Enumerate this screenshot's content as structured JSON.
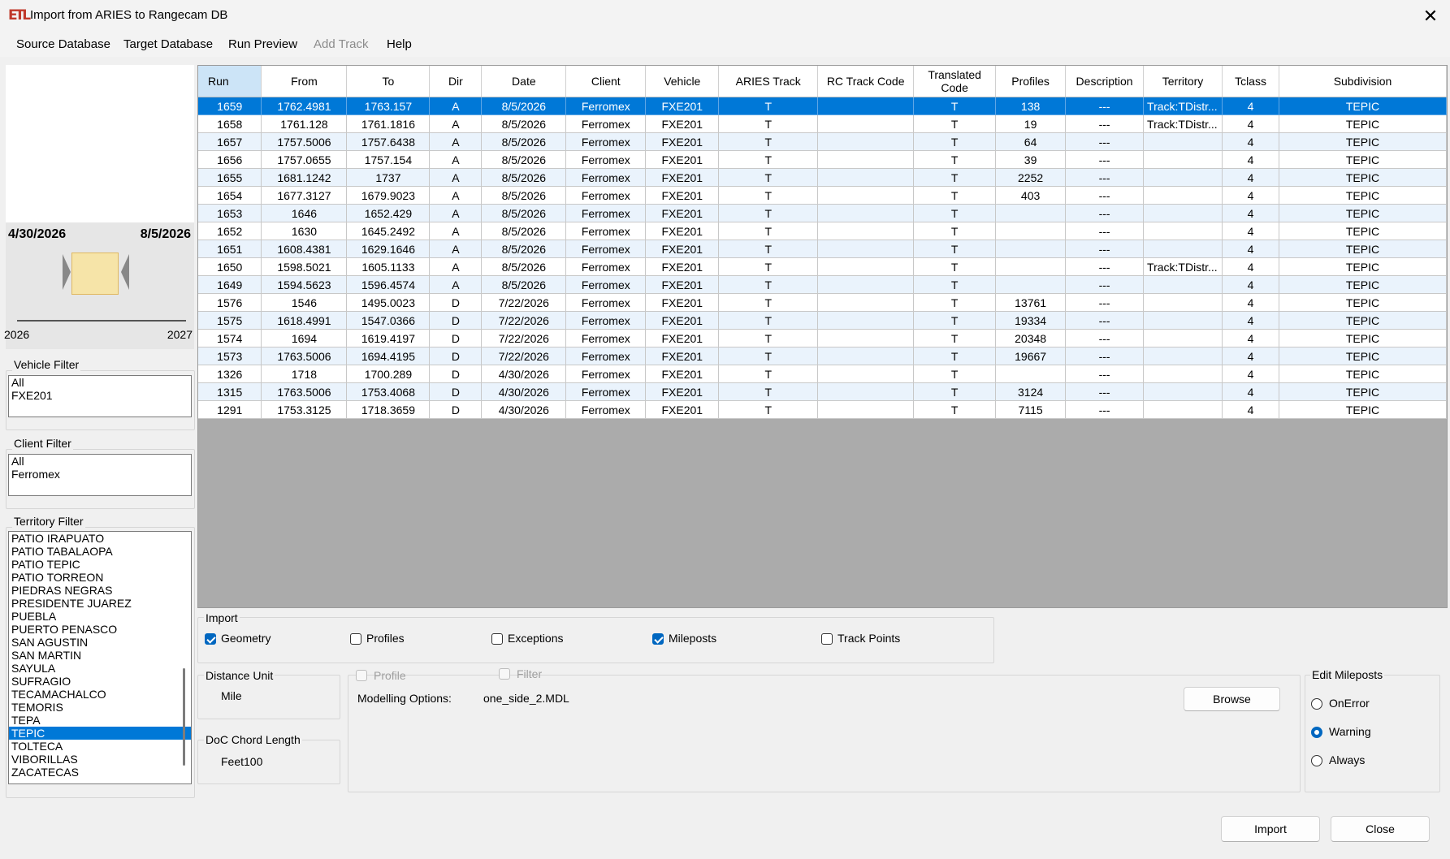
{
  "window": {
    "title": "Import from ARIES to Rangecam DB",
    "app_icon": "ETL",
    "close_symbol": "✕"
  },
  "menu": [
    {
      "label": "Source Database",
      "enabled": true
    },
    {
      "label": "Target Database",
      "enabled": true
    },
    {
      "label": "Run Preview",
      "enabled": true
    },
    {
      "label": "Add Track",
      "enabled": false
    },
    {
      "label": "Help",
      "enabled": true
    }
  ],
  "date_range": {
    "start": "4/30/2026",
    "end": "8/5/2026",
    "axis_start": "2026",
    "axis_end": "2027"
  },
  "vehicle_filter": {
    "label": "Vehicle Filter",
    "items": [
      "All",
      "FXE201"
    ]
  },
  "client_filter": {
    "label": "Client Filter",
    "items": [
      "All",
      "Ferromex"
    ]
  },
  "territory_filter": {
    "label": "Territory Filter",
    "items": [
      "PATIO IRAPUATO",
      "PATIO TABALAOPA",
      "PATIO TEPIC",
      "PATIO TORREON",
      "PIEDRAS NEGRAS",
      "PRESIDENTE JUAREZ",
      "PUEBLA",
      "PUERTO PENASCO",
      "SAN AGUSTIN",
      "SAN MARTIN",
      "SAYULA",
      "SUFRAGIO",
      "TECAMACHALCO",
      "TEMORIS",
      "TEPA",
      "TEPIC",
      "TOLTECA",
      "VIBORILLAS",
      "ZACATECAS"
    ],
    "selected": "TEPIC"
  },
  "grid": {
    "columns": [
      "Run",
      "From",
      "To",
      "Dir",
      "Date",
      "Client",
      "Vehicle",
      "ARIES Track",
      "RC Track Code",
      "Translated Code",
      "Profiles",
      "Description",
      "Territory",
      "Tclass",
      "Subdivision"
    ],
    "sorted_column": "Run",
    "selected_row": 0,
    "rows": [
      [
        "1659",
        "1762.4981",
        "1763.157",
        "A",
        "8/5/2026",
        "Ferromex",
        "FXE201",
        "T",
        "",
        "T",
        "138",
        "---",
        "Track:TDistr...",
        "4",
        "TEPIC"
      ],
      [
        "1658",
        "1761.128",
        "1761.1816",
        "A",
        "8/5/2026",
        "Ferromex",
        "FXE201",
        "T",
        "",
        "T",
        "19",
        "---",
        "Track:TDistr...",
        "4",
        "TEPIC"
      ],
      [
        "1657",
        "1757.5006",
        "1757.6438",
        "A",
        "8/5/2026",
        "Ferromex",
        "FXE201",
        "T",
        "",
        "T",
        "64",
        "---",
        "",
        "4",
        "TEPIC"
      ],
      [
        "1656",
        "1757.0655",
        "1757.154",
        "A",
        "8/5/2026",
        "Ferromex",
        "FXE201",
        "T",
        "",
        "T",
        "39",
        "---",
        "",
        "4",
        "TEPIC"
      ],
      [
        "1655",
        "1681.1242",
        "1737",
        "A",
        "8/5/2026",
        "Ferromex",
        "FXE201",
        "T",
        "",
        "T",
        "2252",
        "---",
        "",
        "4",
        "TEPIC"
      ],
      [
        "1654",
        "1677.3127",
        "1679.9023",
        "A",
        "8/5/2026",
        "Ferromex",
        "FXE201",
        "T",
        "",
        "T",
        "403",
        "---",
        "",
        "4",
        "TEPIC"
      ],
      [
        "1653",
        "1646",
        "1652.429",
        "A",
        "8/5/2026",
        "Ferromex",
        "FXE201",
        "T",
        "",
        "T",
        "",
        "---",
        "",
        "4",
        "TEPIC"
      ],
      [
        "1652",
        "1630",
        "1645.2492",
        "A",
        "8/5/2026",
        "Ferromex",
        "FXE201",
        "T",
        "",
        "T",
        "",
        "---",
        "",
        "4",
        "TEPIC"
      ],
      [
        "1651",
        "1608.4381",
        "1629.1646",
        "A",
        "8/5/2026",
        "Ferromex",
        "FXE201",
        "T",
        "",
        "T",
        "",
        "---",
        "",
        "4",
        "TEPIC"
      ],
      [
        "1650",
        "1598.5021",
        "1605.1133",
        "A",
        "8/5/2026",
        "Ferromex",
        "FXE201",
        "T",
        "",
        "T",
        "",
        "---",
        "Track:TDistr...",
        "4",
        "TEPIC"
      ],
      [
        "1649",
        "1594.5623",
        "1596.4574",
        "A",
        "8/5/2026",
        "Ferromex",
        "FXE201",
        "T",
        "",
        "T",
        "",
        "---",
        "",
        "4",
        "TEPIC"
      ],
      [
        "1576",
        "1546",
        "1495.0023",
        "D",
        "7/22/2026",
        "Ferromex",
        "FXE201",
        "T",
        "",
        "T",
        "13761",
        "---",
        "",
        "4",
        "TEPIC"
      ],
      [
        "1575",
        "1618.4991",
        "1547.0366",
        "D",
        "7/22/2026",
        "Ferromex",
        "FXE201",
        "T",
        "",
        "T",
        "19334",
        "---",
        "",
        "4",
        "TEPIC"
      ],
      [
        "1574",
        "1694",
        "1619.4197",
        "D",
        "7/22/2026",
        "Ferromex",
        "FXE201",
        "T",
        "",
        "T",
        "20348",
        "---",
        "",
        "4",
        "TEPIC"
      ],
      [
        "1573",
        "1763.5006",
        "1694.4195",
        "D",
        "7/22/2026",
        "Ferromex",
        "FXE201",
        "T",
        "",
        "T",
        "19667",
        "---",
        "",
        "4",
        "TEPIC"
      ],
      [
        "1326",
        "1718",
        "1700.289",
        "D",
        "4/30/2026",
        "Ferromex",
        "FXE201",
        "T",
        "",
        "T",
        "",
        "---",
        "",
        "4",
        "TEPIC"
      ],
      [
        "1315",
        "1763.5006",
        "1753.4068",
        "D",
        "4/30/2026",
        "Ferromex",
        "FXE201",
        "T",
        "",
        "T",
        "3124",
        "---",
        "",
        "4",
        "TEPIC"
      ],
      [
        "1291",
        "1753.3125",
        "1718.3659",
        "D",
        "4/30/2026",
        "Ferromex",
        "FXE201",
        "T",
        "",
        "T",
        "7115",
        "---",
        "",
        "4",
        "TEPIC"
      ]
    ]
  },
  "import_group": {
    "label": "Import",
    "options": [
      {
        "label": "Geometry",
        "checked": true
      },
      {
        "label": "Profiles",
        "checked": false
      },
      {
        "label": "Exceptions",
        "checked": false
      },
      {
        "label": "Mileposts",
        "checked": true
      },
      {
        "label": "Track Points",
        "checked": false
      }
    ]
  },
  "distance_unit": {
    "label": "Distance Unit",
    "value": "Mile"
  },
  "doc_chord": {
    "label": "DoC Chord Length",
    "value": "Feet100"
  },
  "modelling": {
    "profile_label": "Profile",
    "filter_label": "Filter",
    "options_label": "Modelling Options:",
    "options_value": "one_side_2.MDL",
    "browse_label": "Browse"
  },
  "edit_mileposts": {
    "label": "Edit Mileposts",
    "options": [
      "OnError",
      "Warning",
      "Always"
    ],
    "selected": "Warning"
  },
  "buttons": {
    "import": "Import",
    "close": "Close"
  },
  "colors": {
    "selection": "#0078d7",
    "accent": "#0067c0",
    "grid_empty": "#ababab"
  }
}
